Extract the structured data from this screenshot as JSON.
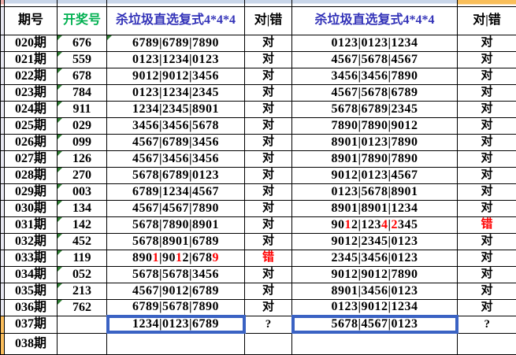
{
  "header": {
    "col_period": "期号",
    "col_draw": "开奖号",
    "col_kill1": "杀垃圾直选复式4*4*4",
    "col_result1": "对|错",
    "col_kill2": "杀垃圾直选复式4*4*4",
    "col_result2": "对|错"
  },
  "colors": {
    "green": "#00B050",
    "blue": "#3333B8",
    "red": "#FF0000",
    "sel": "#3A62C3",
    "strip": "#C9D6E9",
    "orange": "#F9BE59",
    "sliver": "#E8E8F2",
    "sliver-pink": "#EFAFAB",
    "sliver-orange": "#FBBE5C",
    "flag": "#2E7D32"
  },
  "rows": [
    {
      "period": "020期",
      "draw": "676",
      "draw_flag": true,
      "k1": "6789|6789|7890",
      "k1_red": [],
      "k1_flag": true,
      "r1": "对",
      "r1_red": false,
      "k2": "0123|0123|1234",
      "k2_red": [],
      "r2": "对",
      "r2_red": false,
      "selected": false,
      "sliver_orange": false
    },
    {
      "period": "021期",
      "draw": "559",
      "draw_flag": true,
      "k1": "0123|1234|0123",
      "k1_red": [],
      "k1_flag": false,
      "r1": "对",
      "r1_red": false,
      "k2": "4567|5678|4567",
      "k2_red": [],
      "r2": "对",
      "r2_red": false,
      "selected": false,
      "sliver_orange": false
    },
    {
      "period": "022期",
      "draw": "678",
      "draw_flag": true,
      "k1": "9012|9012|3456",
      "k1_red": [],
      "k1_flag": false,
      "r1": "对",
      "r1_red": false,
      "k2": "3456|3456|7890",
      "k2_red": [],
      "r2": "对",
      "r2_red": false,
      "selected": false,
      "sliver_orange": false
    },
    {
      "period": "023期",
      "draw": "784",
      "draw_flag": true,
      "k1": "0123|1234|2345",
      "k1_red": [],
      "k1_flag": false,
      "r1": "对",
      "r1_red": false,
      "k2": "4567|5678|6789",
      "k2_red": [],
      "r2": "对",
      "r2_red": false,
      "selected": false,
      "sliver_orange": false
    },
    {
      "period": "024期",
      "draw": "911",
      "draw_flag": true,
      "k1": "1234|2345|8901",
      "k1_red": [],
      "k1_flag": false,
      "r1": "对",
      "r1_red": false,
      "k2": "5678|6789|2345",
      "k2_red": [],
      "r2": "对",
      "r2_red": false,
      "selected": false,
      "sliver_orange": false
    },
    {
      "period": "025期",
      "draw": "029",
      "draw_flag": true,
      "k1": "3456|3456|5678",
      "k1_red": [],
      "k1_flag": false,
      "r1": "对",
      "r1_red": false,
      "k2": "7890|7890|9012",
      "k2_red": [],
      "r2": "对",
      "r2_red": false,
      "selected": false,
      "sliver_orange": false
    },
    {
      "period": "026期",
      "draw": "099",
      "draw_flag": true,
      "k1": "4567|6789|3456",
      "k1_red": [],
      "k1_flag": false,
      "r1": "对",
      "r1_red": false,
      "k2": "8901|0123|7890",
      "k2_red": [],
      "r2": "对",
      "r2_red": false,
      "selected": false,
      "sliver_orange": false
    },
    {
      "period": "027期",
      "draw": "126",
      "draw_flag": true,
      "k1": "4567|3456|3456",
      "k1_red": [],
      "k1_flag": false,
      "r1": "对",
      "r1_red": false,
      "k2": "8901|7890|7890",
      "k2_red": [],
      "r2": "对",
      "r2_red": false,
      "selected": false,
      "sliver_orange": false
    },
    {
      "period": "028期",
      "draw": "270",
      "draw_flag": true,
      "k1": "5678|6789|0123",
      "k1_red": [],
      "k1_flag": false,
      "r1": "对",
      "r1_red": false,
      "k2": "9012|0123|4567",
      "k2_red": [],
      "r2": "对",
      "r2_red": false,
      "selected": false,
      "sliver_orange": false
    },
    {
      "period": "029期",
      "draw": "003",
      "draw_flag": true,
      "k1": "6789|1234|4567",
      "k1_red": [],
      "k1_flag": false,
      "r1": "对",
      "r1_red": false,
      "k2": "0123|5678|8901",
      "k2_red": [],
      "r2": "对",
      "r2_red": false,
      "selected": false,
      "sliver_orange": false
    },
    {
      "period": "030期",
      "draw": "134",
      "draw_flag": true,
      "k1": "4567|4567|7890",
      "k1_red": [],
      "k1_flag": false,
      "r1": "对",
      "r1_red": false,
      "k2": "8901|8901|1234",
      "k2_red": [],
      "r2": "对",
      "r2_red": false,
      "selected": false,
      "sliver_orange": false
    },
    {
      "period": "031期",
      "draw": "142",
      "draw_flag": true,
      "k1": "5678|7890|8901",
      "k1_red": [],
      "k1_flag": false,
      "r1": "对",
      "r1_red": false,
      "k2": "9012|1234|2345",
      "k2_red": [
        2,
        8,
        10
      ],
      "r2": "错",
      "r2_red": true,
      "selected": false,
      "sliver_orange": false
    },
    {
      "period": "032期",
      "draw": "452",
      "draw_flag": true,
      "k1": "5678|8901|6789",
      "k1_red": [],
      "k1_flag": false,
      "r1": "对",
      "r1_red": false,
      "k2": "9012|2345|0123",
      "k2_red": [],
      "r2": "对",
      "r2_red": false,
      "selected": false,
      "sliver_orange": false
    },
    {
      "period": "033期",
      "draw": "119",
      "draw_flag": true,
      "k1": "8901|9012|6789",
      "k1_red": [
        3,
        7,
        13
      ],
      "k1_flag": false,
      "r1": "错",
      "r1_red": true,
      "k2": "2345|3456|0123",
      "k2_red": [],
      "r2": "对",
      "r2_red": false,
      "selected": false,
      "sliver_orange": false
    },
    {
      "period": "034期",
      "draw": "052",
      "draw_flag": true,
      "k1": "5678|5678|3456",
      "k1_red": [],
      "k1_flag": false,
      "r1": "对",
      "r1_red": false,
      "k2": "9012|9012|7890",
      "k2_red": [],
      "r2": "对",
      "r2_red": false,
      "selected": false,
      "sliver_orange": false
    },
    {
      "period": "035期",
      "draw": "213",
      "draw_flag": true,
      "k1": "4567|9012|6789",
      "k1_red": [],
      "k1_flag": false,
      "r1": "对",
      "r1_red": false,
      "k2": "8901|3456|0123",
      "k2_red": [],
      "r2": "对",
      "r2_red": false,
      "selected": false,
      "sliver_orange": false
    },
    {
      "period": "036期",
      "draw": "762",
      "draw_flag": true,
      "k1": "6789|5678|7890",
      "k1_red": [],
      "k1_flag": false,
      "r1": "对",
      "r1_red": false,
      "k2": "0123|9012|1234",
      "k2_red": [],
      "r2": "对",
      "r2_red": false,
      "selected": false,
      "sliver_orange": false
    },
    {
      "period": "037期",
      "draw": "",
      "draw_flag": false,
      "k1": "1234|0123|6789",
      "k1_red": [],
      "k1_flag": false,
      "r1": "?",
      "r1_red": false,
      "k2": "5678|4567|0123",
      "k2_red": [],
      "r2": "?",
      "r2_red": false,
      "selected": true,
      "sliver_orange": true
    },
    {
      "period": "038期",
      "draw": "",
      "draw_flag": false,
      "k1": "",
      "k1_red": [],
      "k1_flag": false,
      "r1": "",
      "r1_red": false,
      "k2": "",
      "k2_red": [],
      "r2": "",
      "r2_red": false,
      "selected": false,
      "sliver_orange": true
    }
  ]
}
